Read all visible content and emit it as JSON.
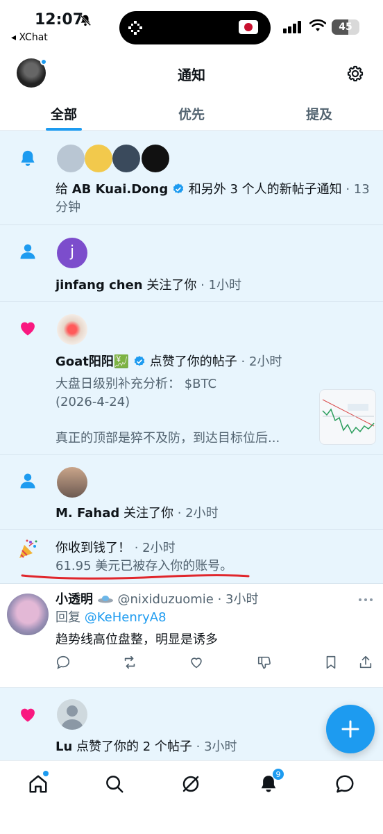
{
  "status": {
    "time": "12:07",
    "back_app": "◂ XChat",
    "battery": "45"
  },
  "header": {
    "title": "通知"
  },
  "tabs": [
    {
      "label": "全部"
    },
    {
      "label": "优先"
    },
    {
      "label": "提及"
    }
  ],
  "notifications": {
    "n1": {
      "prefix": "给 ",
      "name": "AB Kuai.Dong",
      "rest": " 和另外 3 个人的新帖子通知",
      "time": " · 13",
      "time2": "分钟"
    },
    "n2": {
      "avatar_letter": "j",
      "name": "jinfang chen",
      "rest": " 关注了你",
      "time": " · 1小时"
    },
    "n3": {
      "name": "Goat阳阳",
      "emoji": "💹",
      "rest": " 点赞了你的帖子",
      "time": " · 2小时",
      "line1": "大盘日级别补充分析： $BTC",
      "line2": "(2026-4-24)",
      "line3": "真正的顶部是猝不及防，到达目标位后..."
    },
    "n4": {
      "name": "M. Fahad",
      "rest": " 关注了你",
      "time": " · 2小时"
    },
    "n5": {
      "title": "你收到钱了！",
      "time": " · 2小时",
      "body": "61.95 美元已被存入你的账号。"
    },
    "n6": {
      "name": "小透明",
      "handle": "@nixiduzuomie",
      "time": " · 3小时",
      "reply_prefix": "回复 ",
      "reply_to": "@KeHenryA8",
      "body": "趋势线高位盘整，明显是诱多"
    },
    "n7": {
      "name": "Lu",
      "rest": " 点赞了你的 2 个帖子",
      "time": " · 3小时"
    }
  },
  "bottom_nav": {
    "badge": "9"
  },
  "colors": {
    "accent": "#1d9bf0",
    "highlight_bg": "#e8f5fd",
    "like": "#f91880",
    "annotation": "#e0262c"
  }
}
